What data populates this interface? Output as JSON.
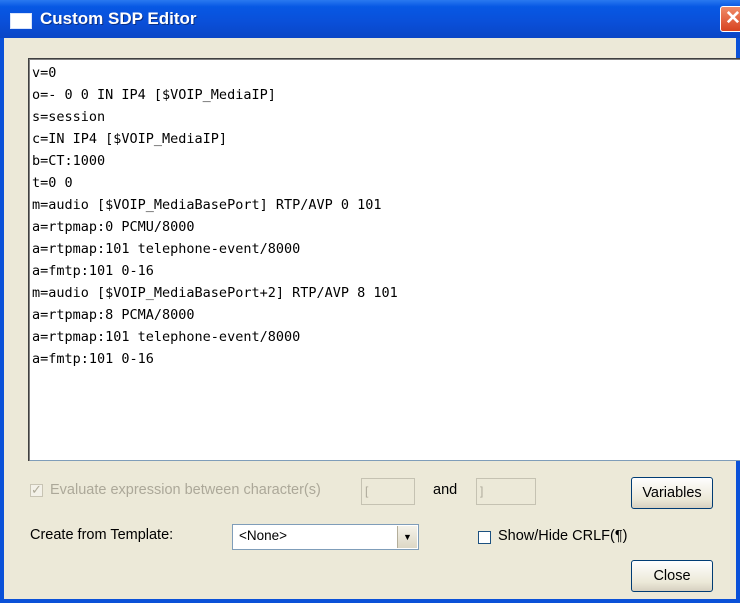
{
  "window": {
    "title": "Custom SDP Editor",
    "close_glyph": "✕",
    "title_icon": "window-icon",
    "colors": {
      "titlebar": "#0a4fd8",
      "face": "#ece9d8",
      "close": "#d7431f"
    }
  },
  "editor": {
    "lines": [
      "v=0",
      "o=- 0 0 IN IP4 [$VOIP_MediaIP]",
      "s=session",
      "c=IN IP4 [$VOIP_MediaIP]",
      "b=CT:1000",
      "t=0 0",
      "m=audio [$VOIP_MediaBasePort] RTP/AVP 0 101",
      "a=rtpmap:0 PCMU/8000",
      "a=rtpmap:101 telephone-event/8000",
      "a=fmtp:101 0-16",
      "m=audio [$VOIP_MediaBasePort+2] RTP/AVP 8 101",
      "a=rtpmap:8 PCMA/8000",
      "a=rtpmap:101 telephone-event/8000",
      "a=fmtp:101 0-16"
    ]
  },
  "evaluate": {
    "label": "Evaluate expression between character(s)",
    "checked": true,
    "enabled": false,
    "start_char": "[",
    "and_label": "and",
    "end_char": "]"
  },
  "buttons": {
    "variables": "Variables",
    "close": "Close"
  },
  "template": {
    "label": "Create from Template:",
    "selected": "<None>",
    "arrow_glyph": "▼"
  },
  "crlf": {
    "label": "Show/Hide CRLF(¶)",
    "checked": false
  }
}
